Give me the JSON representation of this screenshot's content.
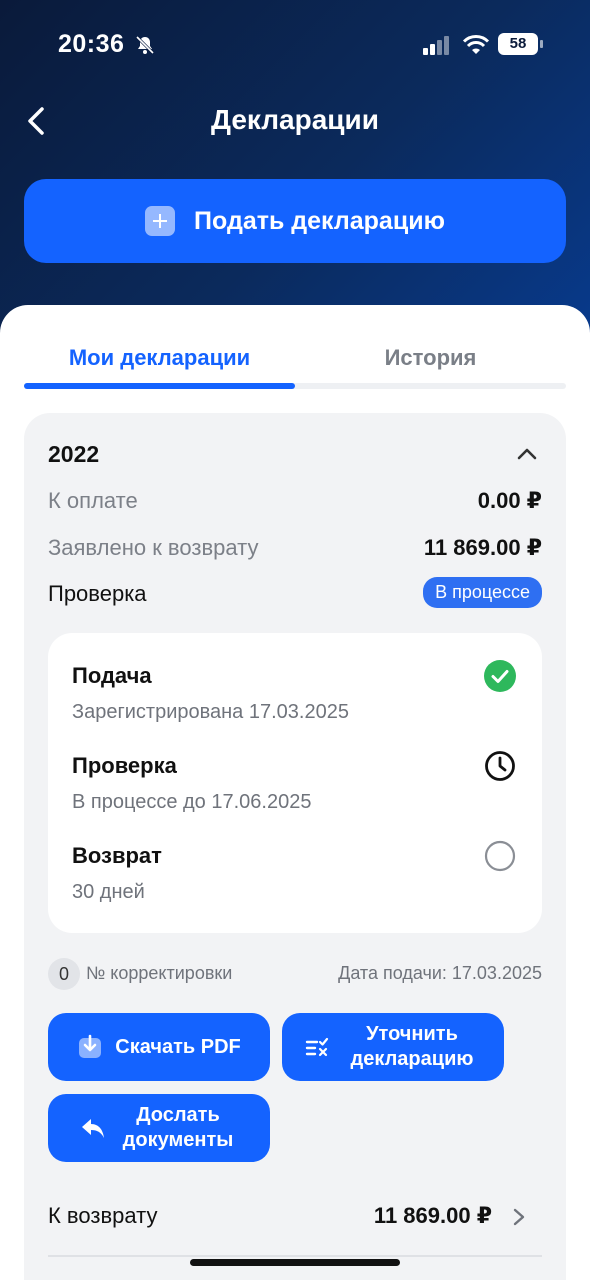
{
  "status_bar": {
    "time": "20:36",
    "battery": "58"
  },
  "header": {
    "title": "Декларации",
    "submit_label": "Подать декларацию"
  },
  "tabs": [
    {
      "label": "Мои декларации",
      "active": true
    },
    {
      "label": "История",
      "active": false
    }
  ],
  "declaration": {
    "year": "2022",
    "to_pay_label": "К оплате",
    "to_pay_value": "0.00 ₽",
    "claimed_label": "Заявлено к возврату",
    "claimed_value": "11 869.00 ₽",
    "check_label": "Проверка",
    "check_status": "В процессе",
    "steps": [
      {
        "title": "Подача",
        "subtitle": "Зарегистрирована 17.03.2025",
        "state": "check-circle-icon"
      },
      {
        "title": "Проверка",
        "subtitle": "В процессе до 17.06.2025",
        "state": "clock-icon"
      },
      {
        "title": "Возврат",
        "subtitle": "30 дней",
        "state": "empty-circle-icon"
      }
    ],
    "correction_count": "0",
    "correction_label": "№ корректировки",
    "submit_date": "Дата подачи: 17.03.2025",
    "buttons": {
      "download": "Скачать PDF",
      "clarify": "Уточнить декларацию",
      "send_docs": "Дослать документы"
    },
    "refund_label": "К возврату",
    "refund_value": "11 869.00 ₽"
  },
  "colors": {
    "accent": "#1463ff",
    "success": "#2eb85c",
    "header_bg": "#0b2a5c"
  }
}
